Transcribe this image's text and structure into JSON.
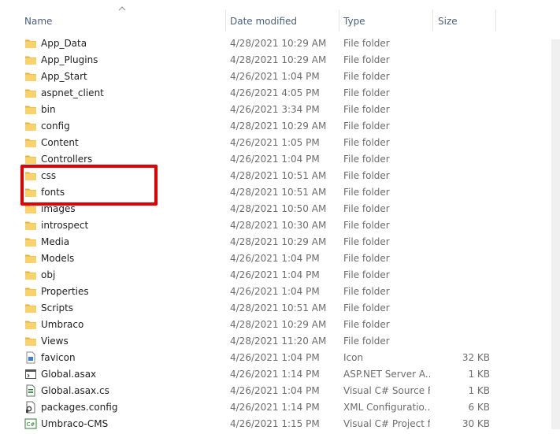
{
  "columns": {
    "name": "Name",
    "date": "Date modified",
    "type": "Type",
    "size": "Size"
  },
  "rows": [
    {
      "name": "App_Data",
      "date": "4/28/2021 10:29 AM",
      "type": "File folder",
      "size": "",
      "icon": "folder-icon"
    },
    {
      "name": "App_Plugins",
      "date": "4/28/2021 10:29 AM",
      "type": "File folder",
      "size": "",
      "icon": "folder-icon"
    },
    {
      "name": "App_Start",
      "date": "4/26/2021 1:04 PM",
      "type": "File folder",
      "size": "",
      "icon": "folder-icon"
    },
    {
      "name": "aspnet_client",
      "date": "4/26/2021 4:05 PM",
      "type": "File folder",
      "size": "",
      "icon": "folder-icon"
    },
    {
      "name": "bin",
      "date": "4/26/2021 3:34 PM",
      "type": "File folder",
      "size": "",
      "icon": "folder-icon"
    },
    {
      "name": "config",
      "date": "4/28/2021 10:29 AM",
      "type": "File folder",
      "size": "",
      "icon": "folder-icon"
    },
    {
      "name": "Content",
      "date": "4/26/2021 1:05 PM",
      "type": "File folder",
      "size": "",
      "icon": "folder-icon"
    },
    {
      "name": "Controllers",
      "date": "4/26/2021 1:04 PM",
      "type": "File folder",
      "size": "",
      "icon": "folder-icon"
    },
    {
      "name": "css",
      "date": "4/28/2021 10:51 AM",
      "type": "File folder",
      "size": "",
      "icon": "folder-icon"
    },
    {
      "name": "fonts",
      "date": "4/28/2021 10:51 AM",
      "type": "File folder",
      "size": "",
      "icon": "folder-icon"
    },
    {
      "name": "images",
      "date": "4/28/2021 10:50 AM",
      "type": "File folder",
      "size": "",
      "icon": "folder-icon"
    },
    {
      "name": "introspect",
      "date": "4/28/2021 10:30 AM",
      "type": "File folder",
      "size": "",
      "icon": "folder-icon"
    },
    {
      "name": "Media",
      "date": "4/28/2021 10:29 AM",
      "type": "File folder",
      "size": "",
      "icon": "folder-icon"
    },
    {
      "name": "Models",
      "date": "4/26/2021 1:04 PM",
      "type": "File folder",
      "size": "",
      "icon": "folder-icon"
    },
    {
      "name": "obj",
      "date": "4/26/2021 1:04 PM",
      "type": "File folder",
      "size": "",
      "icon": "folder-icon"
    },
    {
      "name": "Properties",
      "date": "4/26/2021 1:04 PM",
      "type": "File folder",
      "size": "",
      "icon": "folder-icon"
    },
    {
      "name": "Scripts",
      "date": "4/28/2021 10:51 AM",
      "type": "File folder",
      "size": "",
      "icon": "folder-icon"
    },
    {
      "name": "Umbraco",
      "date": "4/28/2021 10:29 AM",
      "type": "File folder",
      "size": "",
      "icon": "folder-icon"
    },
    {
      "name": "Views",
      "date": "4/28/2021 11:20 AM",
      "type": "File folder",
      "size": "",
      "icon": "folder-icon"
    },
    {
      "name": "favicon",
      "date": "4/26/2021 1:04 PM",
      "type": "Icon",
      "size": "32 KB",
      "icon": "icon-file-icon"
    },
    {
      "name": "Global.asax",
      "date": "4/26/2021 1:14 PM",
      "type": "ASP.NET Server A...",
      "size": "1 KB",
      "icon": "asax-file-icon"
    },
    {
      "name": "Global.asax.cs",
      "date": "4/26/2021 1:04 PM",
      "type": "Visual C# Source F...",
      "size": "1 KB",
      "icon": "cs-file-icon"
    },
    {
      "name": "packages.config",
      "date": "4/26/2021 1:14 PM",
      "type": "XML Configuratio...",
      "size": "6 KB",
      "icon": "config-file-icon"
    },
    {
      "name": "Umbraco-CMS",
      "date": "4/26/2021 1:15 PM",
      "type": "Visual C# Project f...",
      "size": "30 KB",
      "icon": "csproj-file-icon"
    }
  ],
  "colors": {
    "folder": "#f4c547",
    "header_text": "#4c607a",
    "highlight": "#e00000"
  }
}
